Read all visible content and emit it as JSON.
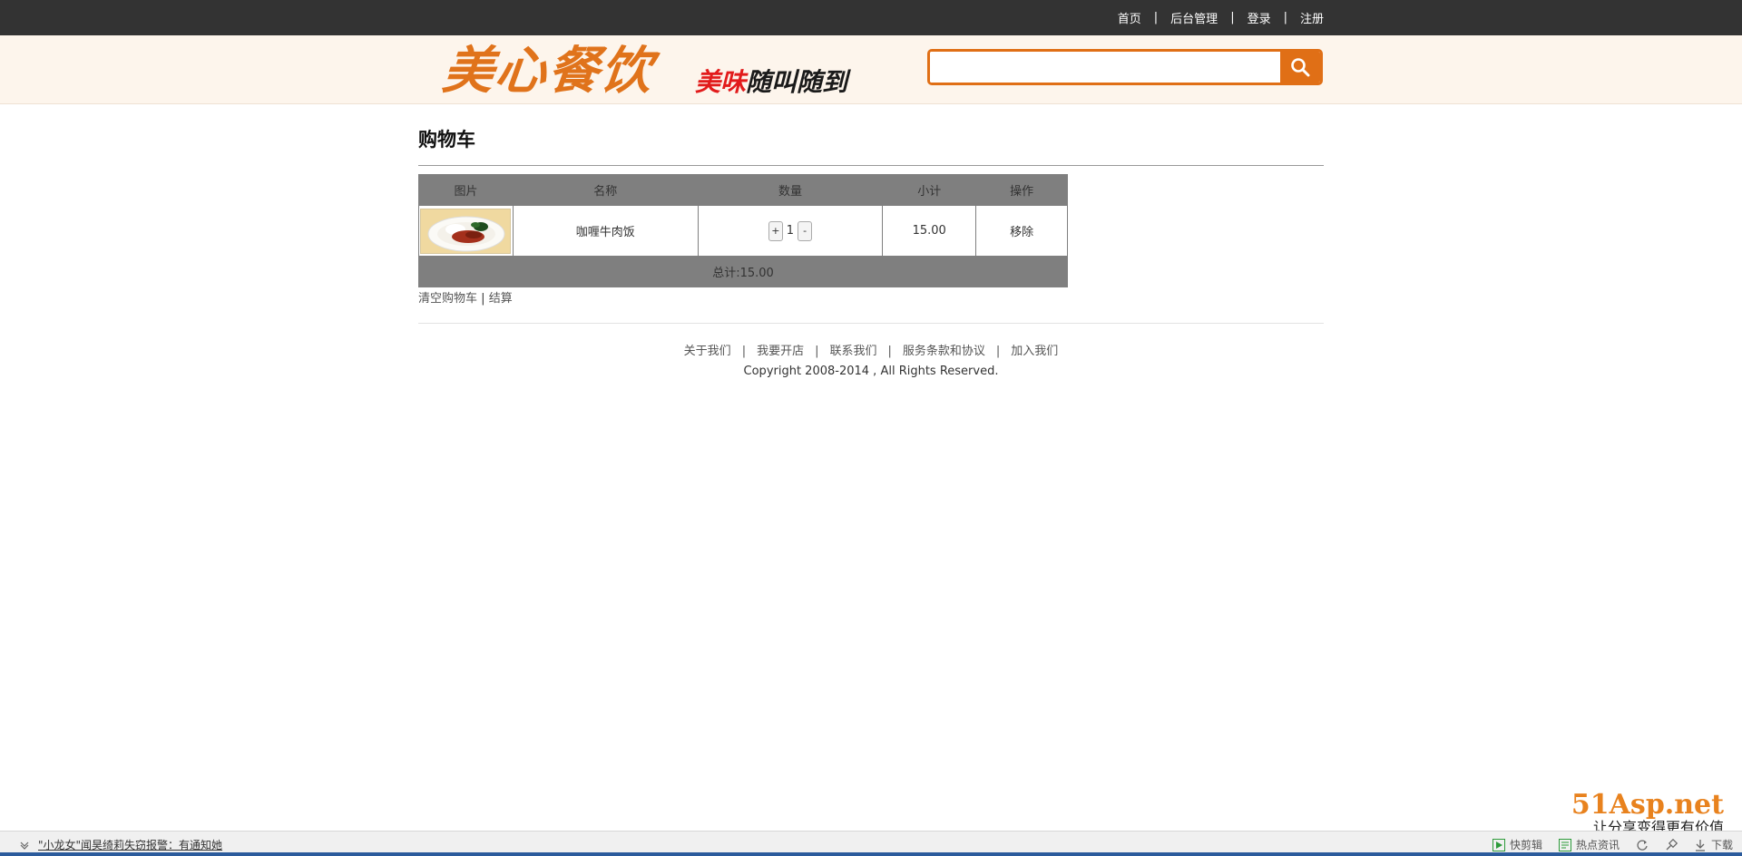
{
  "topnav": {
    "items": [
      "首页",
      "后台管理",
      "登录",
      "注册"
    ],
    "separator": "|"
  },
  "header": {
    "logo": "美心餐饮",
    "slogan_red": "美味",
    "slogan_dark": "随叫随到",
    "search_placeholder": "",
    "search_icon": "search-icon",
    "accent_color": "#e06f16"
  },
  "cart": {
    "title": "购物车",
    "columns": [
      "图片",
      "名称",
      "数量",
      "小计",
      "操作"
    ],
    "items": [
      {
        "name": "咖喱牛肉饭",
        "qty_plus": "+",
        "qty": "1",
        "qty_minus": "-",
        "subtotal": "15.00",
        "action": "移除"
      }
    ],
    "total": "总计:15.00",
    "clear_label": "清空购物车",
    "link_sep": "|",
    "checkout_label": "结算"
  },
  "footer": {
    "links": [
      "关于我们",
      "我要开店",
      "联系我们",
      "服务条款和协议",
      "加入我们"
    ],
    "separator": "|",
    "copyright": "Copyright 2008-2014 , All Rights Reserved."
  },
  "watermark": {
    "brand": "51Asp.net",
    "slogan": "让分享变得更有价值"
  },
  "statusbar": {
    "news": "\"小龙女\"闻昊绮莉失窃报警：有通知她",
    "tools": [
      "快剪辑",
      "热点资讯",
      "下载"
    ]
  }
}
